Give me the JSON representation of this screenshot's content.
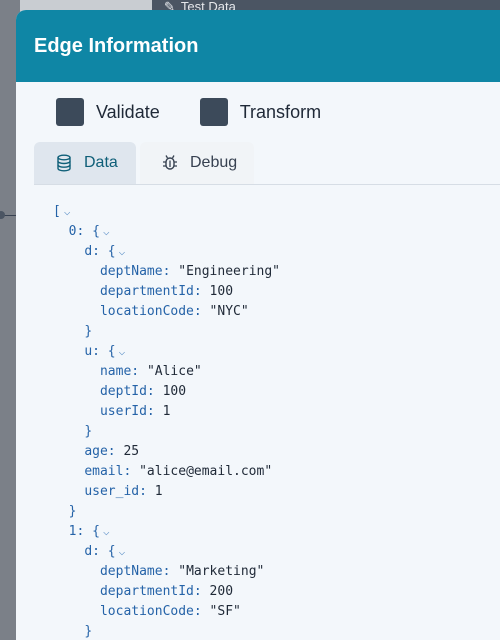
{
  "background": {
    "top_tab_label": "Test Data"
  },
  "panel": {
    "title": "Edge Information",
    "toggles": [
      {
        "label": "Validate",
        "checked": true
      },
      {
        "label": "Transform",
        "checked": true
      }
    ],
    "tabs": [
      {
        "label": "Data",
        "icon": "database-icon",
        "active": true
      },
      {
        "label": "Debug",
        "icon": "bug-icon",
        "active": false
      }
    ]
  },
  "json_view": {
    "items": [
      {
        "index": "0",
        "d": {
          "deptName": "\"Engineering\"",
          "departmentId": "100",
          "locationCode": "\"NYC\""
        },
        "u": {
          "name": "\"Alice\"",
          "deptId": "100",
          "userId": "1"
        },
        "age": "25",
        "email": "\"alice@email.com\"",
        "user_id": "1"
      },
      {
        "index": "1",
        "d": {
          "deptName": "\"Marketing\"",
          "departmentId": "200",
          "locationCode": "\"SF\""
        }
      }
    ]
  },
  "colors": {
    "header": "#0f86a5",
    "checkbox": "#3c4a5a",
    "json_key": "#2563a8",
    "active_tab_text": "#0f5f78"
  }
}
